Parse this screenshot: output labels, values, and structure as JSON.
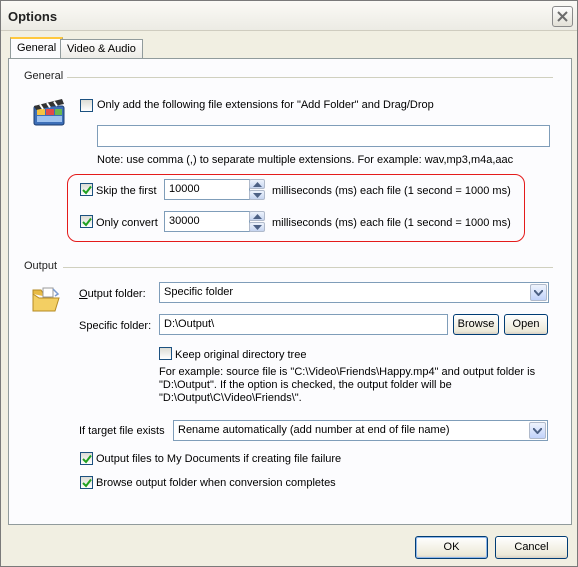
{
  "window": {
    "title": "Options"
  },
  "tabs": [
    {
      "label": "General"
    },
    {
      "label": "Video & Audio"
    }
  ],
  "general": {
    "section_label": "General",
    "only_add_ext": {
      "label": "Only add the following file extensions for \"Add Folder\" and Drag/Drop",
      "checked": false,
      "value": ""
    },
    "ext_note": "Note: use comma (,) to separate multiple extensions. For example: wav,mp3,m4a,aac",
    "skip_first": {
      "label": "Skip the first",
      "checked": true,
      "value": "10000",
      "unit": "milliseconds (ms) each file (1 second = 1000 ms)"
    },
    "only_convert": {
      "label": "Only convert",
      "checked": true,
      "value": "30000",
      "unit": "milliseconds (ms) each file (1 second = 1000 ms)"
    }
  },
  "output": {
    "section_label": "Output",
    "output_folder_label": "Output folder:",
    "output_folder_value": "Specific folder",
    "specific_folder_label": "Specific folder:",
    "specific_folder_value": "D:\\Output\\",
    "browse_label": "Browse",
    "open_label": "Open",
    "keep_tree": {
      "label": "Keep original directory tree",
      "checked": false
    },
    "example_lines": [
      "For example: source file is \"C:\\Video\\Friends\\Happy.mp4\" and output folder is",
      "\"D:\\Output\". If the option is checked, the output folder will be",
      "\"D:\\Output\\C\\Video\\Friends\\\"."
    ],
    "if_exists_label": "If target file exists",
    "if_exists_value": "Rename automatically (add number at end of file name)",
    "my_documents": {
      "label": "Output files to My Documents if creating file failure",
      "checked": true
    },
    "browse_when_done": {
      "label": "Browse output folder when conversion completes",
      "checked": true
    }
  },
  "footer": {
    "ok_label": "OK",
    "cancel_label": "Cancel"
  },
  "colors": {
    "highlight": "#e41b1b",
    "tab_accent": "#ffc83c",
    "dialog_bg": "#f1efe2"
  },
  "icons": [
    "close-icon",
    "clapperboard-icon",
    "folder-icon",
    "checkmark-icon",
    "spin-up-icon",
    "spin-down-icon",
    "dropdown-arrow-icon"
  ]
}
